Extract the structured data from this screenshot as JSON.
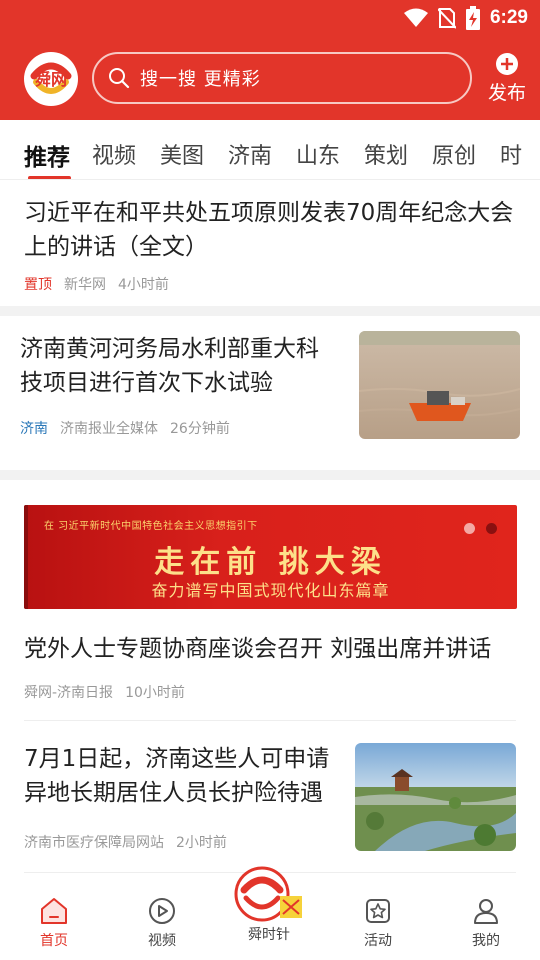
{
  "status_bar": {
    "time": "6:29"
  },
  "header": {
    "search_placeholder": "搜一搜 更精彩",
    "publish_label": "发布"
  },
  "tabs": [
    {
      "label": "推荐",
      "active": true
    },
    {
      "label": "视频"
    },
    {
      "label": "美图"
    },
    {
      "label": "济南"
    },
    {
      "label": "山东"
    },
    {
      "label": "策划"
    },
    {
      "label": "原创"
    },
    {
      "label": "时"
    }
  ],
  "articles": [
    {
      "title": "习近平在和平共处五项原则发表70周年纪念大会上的讲话（全文）",
      "tag": "置顶",
      "source": "新华网",
      "time": "4小时前"
    },
    {
      "title": "济南黄河河务局水利部重大科技项目进行首次下水试验",
      "tag": "济南",
      "source": "济南报业全媒体",
      "time": "26分钟前"
    },
    {
      "title": "党外人士专题协商座谈会召开 刘强出席并讲话",
      "source": "舜网-济南日报",
      "time": "10小时前"
    },
    {
      "title": "7月1日起，济南这些人可申请异地长期居住人员长护险待遇",
      "source": "济南市医疗保障局网站",
      "time": "2小时前"
    }
  ],
  "banner": {
    "top_text": "在 习近平新时代中国特色社会主义思想指引下",
    "main_text": "走在前 挑大梁",
    "sub_text": "奋力谱写中国式现代化山东篇章"
  },
  "bottom_nav": [
    {
      "label": "首页",
      "icon": "home-icon",
      "active": true
    },
    {
      "label": "视频",
      "icon": "video-icon"
    },
    {
      "label": "舜时针",
      "icon": "shun-logo-icon"
    },
    {
      "label": "活动",
      "icon": "activity-icon"
    },
    {
      "label": "我的",
      "icon": "user-icon"
    }
  ],
  "logo_text": "舜网",
  "colors": {
    "brand_red": "#e2352a",
    "city_tag_blue": "#2b78b8",
    "meta_gray": "#999999"
  }
}
